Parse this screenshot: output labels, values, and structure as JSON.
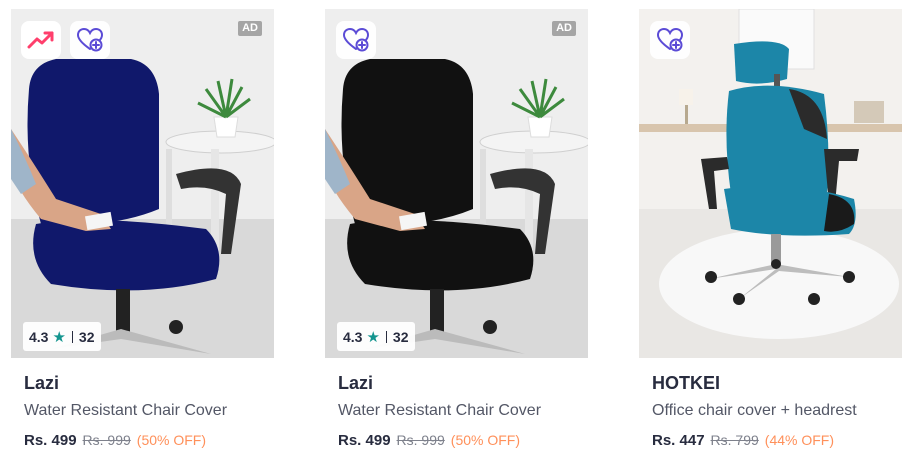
{
  "products": [
    {
      "brand": "Lazi",
      "title": "Water Resistant Chair Cover",
      "price": "Rs. 499",
      "mrp": "Rs. 999",
      "discount": "(50% OFF)",
      "rating": "4.3",
      "rating_count": "32",
      "ad_label": "AD",
      "trending_icon": "trending-up-icon",
      "wishlist_icon": "heart-plus-icon"
    },
    {
      "brand": "Lazi",
      "title": "Water Resistant Chair Cover",
      "price": "Rs. 499",
      "mrp": "Rs. 999",
      "discount": "(50% OFF)",
      "rating": "4.3",
      "rating_count": "32",
      "ad_label": "AD",
      "wishlist_icon": "heart-plus-icon"
    },
    {
      "brand": "HOTKEI",
      "title": "Office chair cover + headrest",
      "price": "Rs. 447",
      "mrp": "Rs. 799",
      "discount": "(44% OFF)",
      "wishlist_icon": "heart-plus-icon"
    }
  ],
  "colors": {
    "rating_star": "#14958f",
    "discount": "#ff905a",
    "trending": "#ff3f6c",
    "wishlist": "#5b4bd6",
    "chair1_cover": "#10186b",
    "chair2_cover": "#111111",
    "chair3_cover": "#1c86a8"
  }
}
